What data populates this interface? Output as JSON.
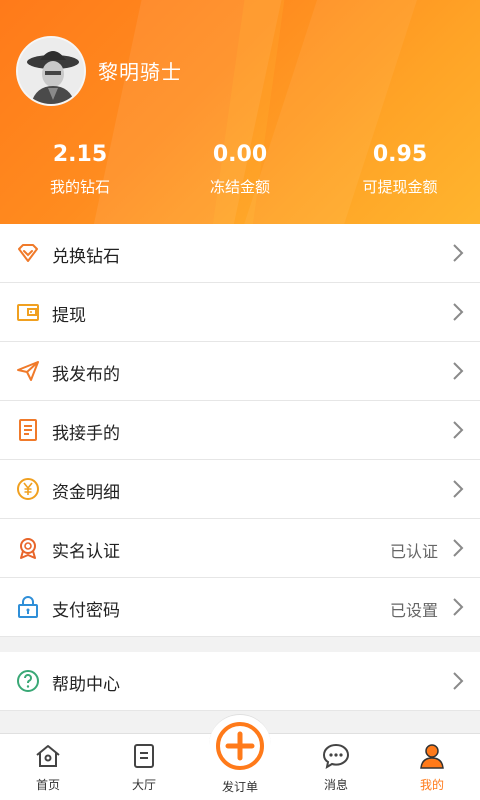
{
  "profile": {
    "username": "黎明骑士"
  },
  "stats": [
    {
      "value": "2.15",
      "label": "我的钻石"
    },
    {
      "value": "0.00",
      "label": "冻结金额"
    },
    {
      "value": "0.95",
      "label": "可提现金额"
    }
  ],
  "menu": [
    {
      "label": "兑换钻石",
      "icon": "diamond-icon",
      "status": ""
    },
    {
      "label": "提现",
      "icon": "wallet-icon",
      "status": ""
    },
    {
      "label": "我发布的",
      "icon": "paper-plane-icon",
      "status": ""
    },
    {
      "label": "我接手的",
      "icon": "document-icon",
      "status": ""
    },
    {
      "label": "资金明细",
      "icon": "yuan-coin-icon",
      "status": ""
    },
    {
      "label": "实名认证",
      "icon": "badge-icon",
      "status": "已认证"
    },
    {
      "label": "支付密码",
      "icon": "lock-icon",
      "status": "已设置"
    }
  ],
  "menu2": [
    {
      "label": "帮助中心",
      "icon": "help-icon",
      "status": ""
    }
  ],
  "nav": [
    {
      "label": "首页",
      "icon": "home-icon"
    },
    {
      "label": "大厅",
      "icon": "hall-icon"
    },
    {
      "label": "发订单",
      "icon": "plus-circle-icon"
    },
    {
      "label": "消息",
      "icon": "message-icon"
    },
    {
      "label": "我的",
      "icon": "person-icon"
    }
  ],
  "colors": {
    "accent": "#ff7a1a",
    "header_gradient_start": "#ff7a1a",
    "header_gradient_end": "#ffb52e",
    "lock_blue": "#2f8fd8",
    "help_green": "#3aa876"
  }
}
